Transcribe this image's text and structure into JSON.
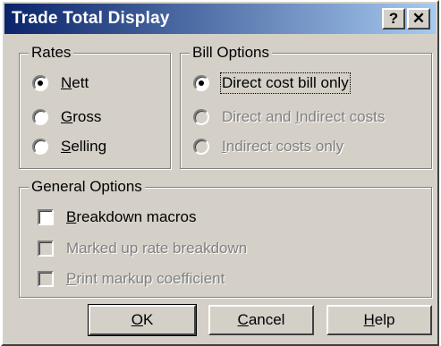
{
  "window": {
    "title": "Trade Total Display",
    "help_glyph": "?",
    "close_glyph": "✕"
  },
  "rates": {
    "legend": "Rates",
    "options": [
      {
        "first": "N",
        "rest": "ett",
        "selected": true,
        "enabled": true
      },
      {
        "first": "G",
        "rest": "ross",
        "selected": false,
        "enabled": true
      },
      {
        "first": "S",
        "rest": "elling",
        "selected": false,
        "enabled": true
      }
    ]
  },
  "bill_options": {
    "legend": "Bill Options",
    "options": [
      {
        "label": "Direct cost bill only",
        "selected": true,
        "enabled": true
      },
      {
        "label_pre": "Direct and ",
        "label_u": "I",
        "label_post": "ndirect costs",
        "selected": false,
        "enabled": false
      },
      {
        "label_u": "I",
        "label_post": "ndirect costs only",
        "selected": false,
        "enabled": false
      }
    ]
  },
  "general_options": {
    "legend": "General Options",
    "checks": [
      {
        "first": "B",
        "rest": "reakdown macros",
        "checked": false,
        "enabled": true
      },
      {
        "label": "Marked up rate breakdown",
        "checked": false,
        "enabled": false
      },
      {
        "first": "P",
        "rest": "rint markup coefficient",
        "checked": false,
        "enabled": false
      }
    ]
  },
  "buttons": {
    "ok": {
      "first": "O",
      "rest": "K"
    },
    "cancel": {
      "first": "C",
      "rest": "ancel"
    },
    "help": {
      "first": "H",
      "rest": "elp"
    }
  }
}
